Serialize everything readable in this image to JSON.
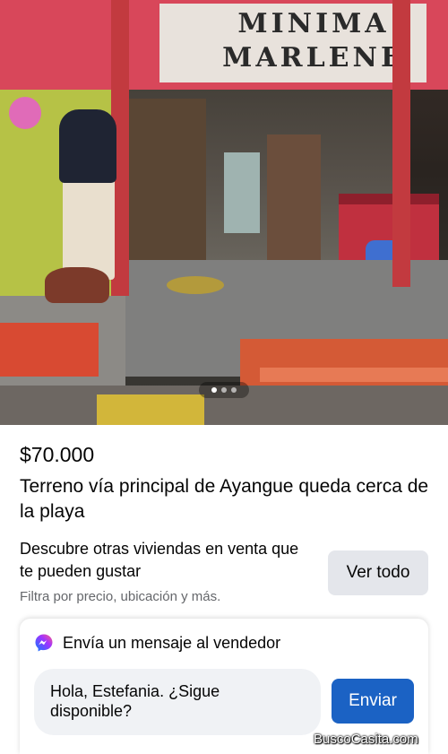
{
  "listing_photo": {
    "sign_text_line1": "MINIMA",
    "sign_text_line2": "MARLENE",
    "carousel": {
      "total": 3,
      "active_index": 0
    }
  },
  "listing": {
    "price": "$70.000",
    "title": "Terreno vía principal de Ayangue queda cerca de la playa"
  },
  "discover": {
    "text": "Descubre otras viviendas en venta que te pueden gustar",
    "subtext": "Filtra por precio, ubicación y más.",
    "see_all_label": "Ver todo"
  },
  "message_seller": {
    "header": "Envía un mensaje al vendedor",
    "icon": "messenger-icon",
    "message_text": "Hola, Estefania. ¿Sigue disponible?",
    "send_label": "Enviar"
  },
  "watermark": "BuscoCasita.com",
  "colors": {
    "send_button": "#1b62c4",
    "secondary_button": "#e4e6eb",
    "subtext": "#65676b",
    "input_background": "#f0f2f5"
  }
}
